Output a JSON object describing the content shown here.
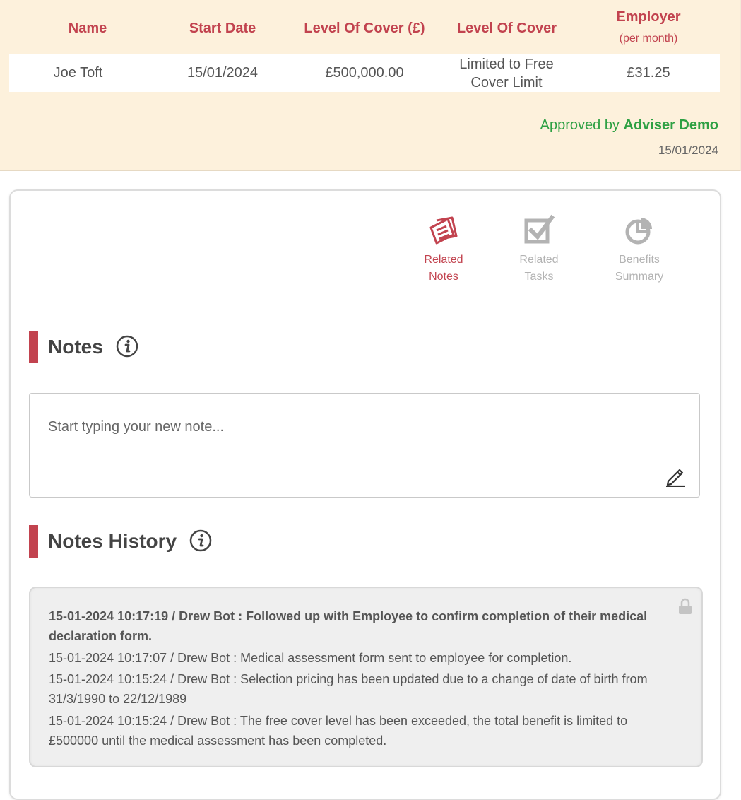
{
  "summary": {
    "headers": {
      "name": "Name",
      "start_date": "Start Date",
      "level_of_cover_gbp": "Level Of Cover (£)",
      "level_of_cover": "Level Of Cover",
      "employer": "Employer",
      "employer_sub": "(per month)"
    },
    "row": {
      "name": "Joe Toft",
      "start_date": "15/01/2024",
      "level_of_cover_gbp": "£500,000.00",
      "level_of_cover_line1": "Limited to Free",
      "level_of_cover_line2": "Cover Limit",
      "employer": "£31.25"
    },
    "approved_prefix": "Approved by",
    "approved_by": "Adviser Demo",
    "approved_date": "15/01/2024"
  },
  "tabs": [
    {
      "line1": "Related",
      "line2": "Notes",
      "icon": "notes-icon",
      "active": true
    },
    {
      "line1": "Related",
      "line2": "Tasks",
      "icon": "checkbox-icon",
      "active": false
    },
    {
      "line1": "Benefits",
      "line2": "Summary",
      "icon": "pie-chart-icon",
      "active": false
    }
  ],
  "notes": {
    "title": "Notes",
    "placeholder": "Start typing your new note..."
  },
  "history": {
    "title": "Notes History",
    "entries": [
      {
        "line1": "15-01-2024 10:17:19 / Drew Bot : Followed up with Employee to confirm completion of their medical",
        "line2": "declaration form.",
        "bold": true
      },
      {
        "line1": "15-01-2024 10:17:07 / Drew Bot : Medical assessment form sent to employee for completion.",
        "line2": "",
        "bold": false
      },
      {
        "line1": "15-01-2024 10:15:24 / Drew Bot : Selection pricing has been updated due to a change of date of birth from",
        "line2": "31/3/1990 to 22/12/1989",
        "bold": false
      },
      {
        "line1": "15-01-2024 10:15:24 / Drew Bot : The free cover level has been exceeded, the total benefit is limited to",
        "line2": "£500000 until the medical assessment has been completed.",
        "bold": false
      }
    ]
  },
  "colors": {
    "accent": "#c2434f",
    "approved": "#2ea043",
    "panel_bg": "#fdf1dc"
  }
}
